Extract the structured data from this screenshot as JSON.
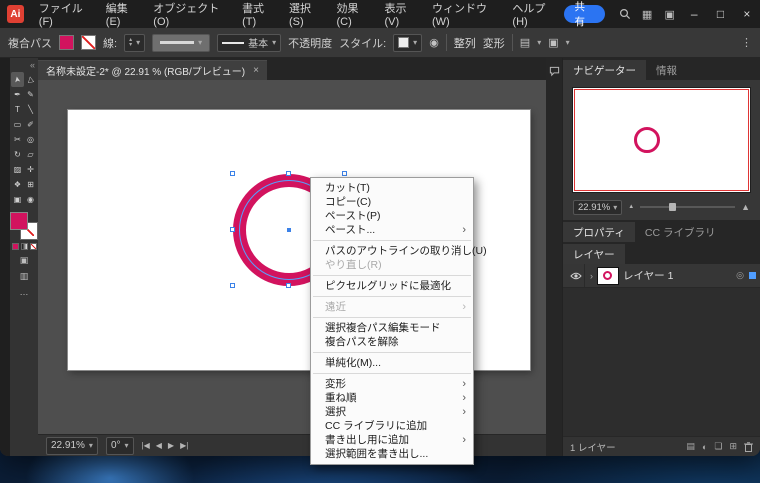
{
  "colors": {
    "accent": "#d2135e",
    "selection": "#4f9dff"
  },
  "icons": {
    "chevron_down": "▾",
    "spinner_up": "▴",
    "spinner_down": "▾",
    "collapse": "«",
    "grid": "▦",
    "workspace": "▣",
    "menu_dots": "⋮",
    "nav_first": "|◀",
    "nav_prev": "◀",
    "nav_next": "▶",
    "nav_last": "▶|",
    "zoom_out_tri": "▲",
    "zoom_in_tri": "▲",
    "target": "◎",
    "expand": "›",
    "recolor": "◉",
    "panel_icon_a": "▤",
    "panel_icon_b": "▣",
    "layers_collect": "▤",
    "layers_mask": "◐",
    "layers_sublayer": "❏",
    "layers_new": "⊞",
    "drawmode": "▣",
    "screenmode": "▥",
    "more_tools": "…"
  },
  "titlebar": {
    "app_icon": "Ai",
    "menus": [
      {
        "name": "menu-file",
        "label": "ファイル(F)"
      },
      {
        "name": "menu-edit",
        "label": "編集(E)"
      },
      {
        "name": "menu-object",
        "label": "オブジェクト(O)"
      },
      {
        "name": "menu-type",
        "label": "書式(T)"
      },
      {
        "name": "menu-select",
        "label": "選択(S)"
      },
      {
        "name": "menu-effect",
        "label": "効果(C)"
      },
      {
        "name": "menu-view",
        "label": "表示(V)"
      },
      {
        "name": "menu-window",
        "label": "ウィンドウ(W)"
      },
      {
        "name": "menu-help",
        "label": "ヘルプ(H)"
      }
    ],
    "share_label": "共有",
    "minimize": "–",
    "maximize": "□",
    "close": "×"
  },
  "options_bar": {
    "object_label": "複合パス",
    "stroke_label": "線:",
    "brush_label": "基本",
    "opacity_label": "不透明度",
    "style_label": "スタイル:",
    "align_label": "整列",
    "transform_label": "変形"
  },
  "toolbar": {
    "tools": [
      {
        "name": "selection-tool",
        "glyph": "➤",
        "active": true
      },
      {
        "name": "direct-selection-tool",
        "glyph": "▷"
      },
      {
        "name": "pen-tool",
        "glyph": "✒"
      },
      {
        "name": "curvature-tool",
        "glyph": "✎"
      },
      {
        "name": "type-tool",
        "glyph": "T"
      },
      {
        "name": "line-segment-tool",
        "glyph": "╲"
      },
      {
        "name": "rectangle-tool",
        "glyph": "▭"
      },
      {
        "name": "paintbrush-tool",
        "glyph": "✐"
      },
      {
        "name": "scissors-tool",
        "glyph": "✂"
      },
      {
        "name": "blob-brush-tool",
        "glyph": "◎"
      },
      {
        "name": "rotate-tool",
        "glyph": "↻"
      },
      {
        "name": "scale-tool",
        "glyph": "▱"
      },
      {
        "name": "gradient-tool",
        "glyph": "▨"
      },
      {
        "name": "eyedropper-tool",
        "glyph": "✛"
      },
      {
        "name": "shape-builder-tool",
        "glyph": "❖"
      },
      {
        "name": "mesh-tool",
        "glyph": "⊞"
      },
      {
        "name": "artboard-tool",
        "glyph": "▣"
      },
      {
        "name": "zoom-tool",
        "glyph": "◉"
      }
    ]
  },
  "document": {
    "tab_title": "名称未設定-2* @ 22.91 % (RGB/プレビュー)",
    "close_glyph": "×",
    "status": {
      "zoom": "22.91%",
      "angle": "0°"
    }
  },
  "context_menu": {
    "items": [
      {
        "name": "ctx-cut",
        "label": "カット(T)"
      },
      {
        "name": "ctx-copy",
        "label": "コピー(C)"
      },
      {
        "name": "ctx-paste",
        "label": "ペースト(P)"
      },
      {
        "name": "ctx-paste-options",
        "label": "ペースト...",
        "sub": "›"
      },
      {
        "separator": true
      },
      {
        "name": "ctx-undo",
        "label": "パスのアウトラインの取り消し(U)"
      },
      {
        "name": "ctx-redo",
        "label": "やり直し(R)",
        "disabled": true
      },
      {
        "separator": true
      },
      {
        "name": "ctx-pixel-grid",
        "label": "ピクセルグリッドに最適化"
      },
      {
        "separator": true
      },
      {
        "name": "ctx-perspective",
        "label": "遠近",
        "sub": "›",
        "disabled": true
      },
      {
        "separator": true
      },
      {
        "name": "ctx-isolate-compound",
        "label": "選択複合パス編集モード"
      },
      {
        "name": "ctx-release-compound",
        "label": "複合パスを解除"
      },
      {
        "separator": true
      },
      {
        "name": "ctx-simplify",
        "label": "単純化(M)..."
      },
      {
        "separator": true
      },
      {
        "name": "ctx-transform",
        "label": "変形",
        "sub": "›"
      },
      {
        "name": "ctx-arrange",
        "label": "重ね順",
        "sub": "›"
      },
      {
        "name": "ctx-select",
        "label": "選択",
        "sub": "›"
      },
      {
        "name": "ctx-add-to-library",
        "label": "CC ライブラリに追加"
      },
      {
        "name": "ctx-add-to-export",
        "label": "書き出し用に追加",
        "sub": "›"
      },
      {
        "name": "ctx-export-selection",
        "label": "選択範囲を書き出し..."
      }
    ]
  },
  "navigator": {
    "tab_navigator": "ナビゲーター",
    "tab_info": "情報",
    "zoom_value": "22.91%"
  },
  "panels": {
    "properties_tab": "プロパティ",
    "libraries_tab": "CC ライブラリ",
    "layers_tab": "レイヤー",
    "layer1_name": "レイヤー 1",
    "layers_count": "1 レイヤー"
  }
}
